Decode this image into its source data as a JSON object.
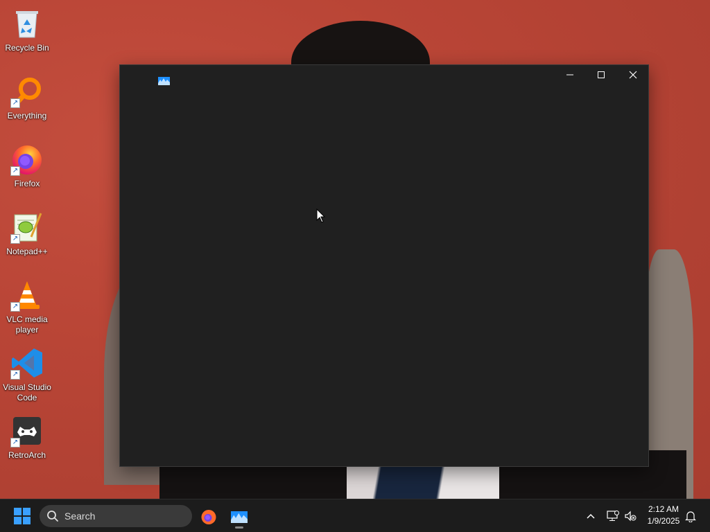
{
  "desktop": {
    "icons": [
      {
        "label": "Recycle Bin",
        "icon": "recycle-bin-icon"
      },
      {
        "label": "Everything",
        "icon": "everything-search-icon"
      },
      {
        "label": "Firefox",
        "icon": "firefox-icon"
      },
      {
        "label": "Notepad++",
        "icon": "notepadpp-icon"
      },
      {
        "label": "VLC media player",
        "icon": "vlc-icon"
      },
      {
        "label": "Visual Studio Code",
        "icon": "vscode-icon"
      },
      {
        "label": "RetroArch",
        "icon": "retroarch-icon"
      }
    ]
  },
  "window": {
    "icon": "app-waveform-icon",
    "background": "#202020",
    "buttons": {
      "minimize": "minimize-icon",
      "maximize": "maximize-icon",
      "close": "close-icon"
    }
  },
  "taskbar": {
    "search_label": "Search",
    "pinned": [
      {
        "name": "Firefox",
        "icon": "firefox-icon"
      },
      {
        "name": "app",
        "icon": "app-waveform-icon"
      }
    ],
    "clock_time": "2:12 AM",
    "clock_date": "1/9/2025"
  },
  "colors": {
    "wallpaper": "#b8473a",
    "window_bg": "#202020",
    "taskbar_bg": "#1c1c1c",
    "accent": "#1e90ff"
  }
}
